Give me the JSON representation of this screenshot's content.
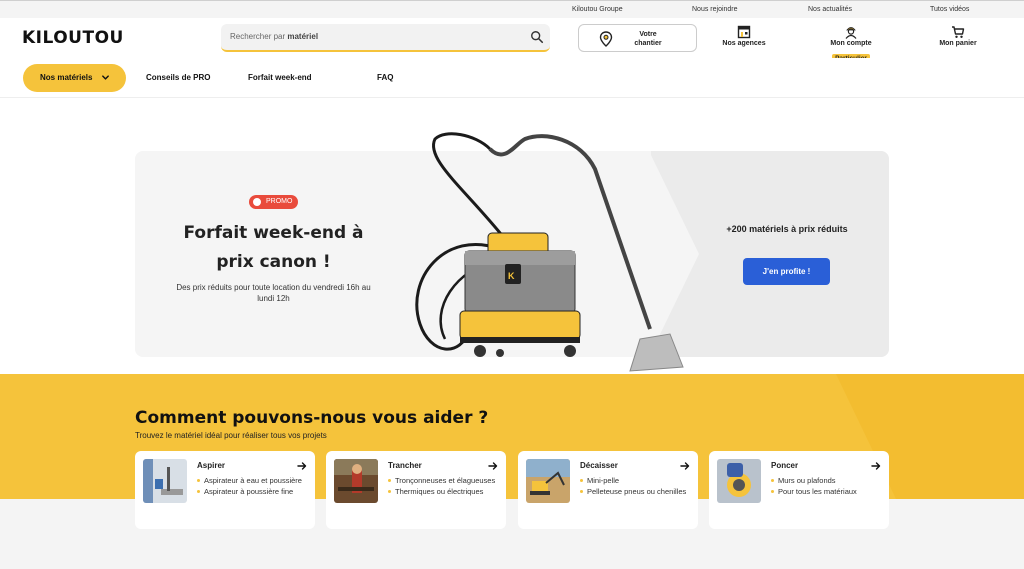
{
  "topbar": {
    "links": [
      "Kiloutou Groupe",
      "Nous rejoindre",
      "Nos actualités",
      "Tutos vidéos"
    ]
  },
  "header": {
    "logo": "KILOUTOU",
    "search": {
      "prefix": "Rechercher par ",
      "keyword": "matériel"
    },
    "chantier_label": "Votre chantier",
    "agences_label": "Nos agences",
    "compte_label": "Mon compte",
    "compte_badge": "Particulier",
    "panier_label": "Mon panier"
  },
  "nav": {
    "main_button": "Nos matériels",
    "links": [
      "Conseils de PRO",
      "Forfait week-end",
      "FAQ"
    ]
  },
  "hero": {
    "badge": "PROMO",
    "title": "Forfait week-end à prix canon !",
    "subtitle": "Des prix réduits pour toute location du vendredi 16h au lundi 12h",
    "right_title": "+200 matériels à prix réduits",
    "cta": "J'en profite !"
  },
  "help": {
    "title": "Comment pouvons-nous vous aider ?",
    "subtitle": "Trouvez le matériel idéal pour réaliser tous vos projets",
    "cards": [
      {
        "title": "Aspirer",
        "items": [
          "Aspirateur à eau et poussière",
          "Aspirateur à poussière fine"
        ]
      },
      {
        "title": "Trancher",
        "items": [
          "Tronçonneuses et élagueuses",
          "Thermiques ou électriques"
        ]
      },
      {
        "title": "Décaisser",
        "items": [
          "Mini-pelle",
          "Pelleteuse pneus ou chenilles"
        ]
      },
      {
        "title": "Poncer",
        "items": [
          "Murs ou plafonds",
          "Pour tous les matériaux"
        ]
      }
    ]
  },
  "colors": {
    "brand_yellow": "#f5c33b",
    "cta_blue": "#2a5fd7",
    "promo_red": "#e94b3c"
  },
  "icons": [
    "search-icon",
    "map-pin-icon",
    "store-icon",
    "user-icon",
    "cart-icon",
    "chevron-down-icon",
    "arrow-right-icon"
  ]
}
